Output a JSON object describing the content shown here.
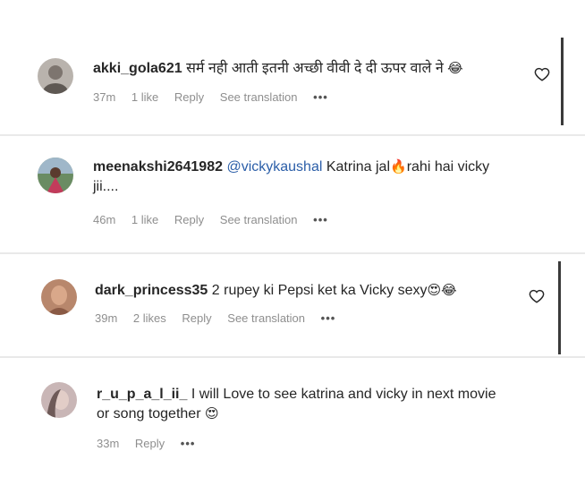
{
  "comments": [
    {
      "username": "akki_gola621",
      "text": "सर्म नही आती इतनी अच्छी वीवी दे दी ऊपर वाले ने",
      "emoji": "😂",
      "time": "37m",
      "likes": "1 like",
      "reply": "Reply",
      "translation": "See translation",
      "more": "•••",
      "avatar_color": "#b9b3ad"
    },
    {
      "username": "meenakshi2641982",
      "mention": "@vickykaushal",
      "text_before_emoji": "Katrina jal",
      "emoji": "🔥",
      "text_after_emoji": "rahi hai vicky",
      "text_line2": "jii....",
      "time": "46m",
      "likes": "1 like",
      "reply": "Reply",
      "translation": "See translation",
      "more": "•••",
      "avatar_color": "#6a8c63"
    },
    {
      "username": "dark_princess35",
      "text": "2 rupey ki Pepsi ket ka Vicky sexy",
      "emoji": "😍😂",
      "time": "39m",
      "likes": "2 likes",
      "reply": "Reply",
      "translation": "See translation",
      "more": "•••",
      "avatar_color": "#b8876c"
    },
    {
      "username": "r_u_p_a_l_ii_",
      "text": "I will Love to see katrina and vicky in next movie",
      "text_line2": "or song together",
      "emoji": "😍",
      "time": "33m",
      "reply": "Reply",
      "more": "•••",
      "avatar_color": "#c9b6b6"
    }
  ],
  "colors": {
    "mention": "#2b5ea8",
    "meta": "#8e8e8e",
    "divider": "#e9e9e9",
    "scrollbar": "#3a3a3a"
  }
}
